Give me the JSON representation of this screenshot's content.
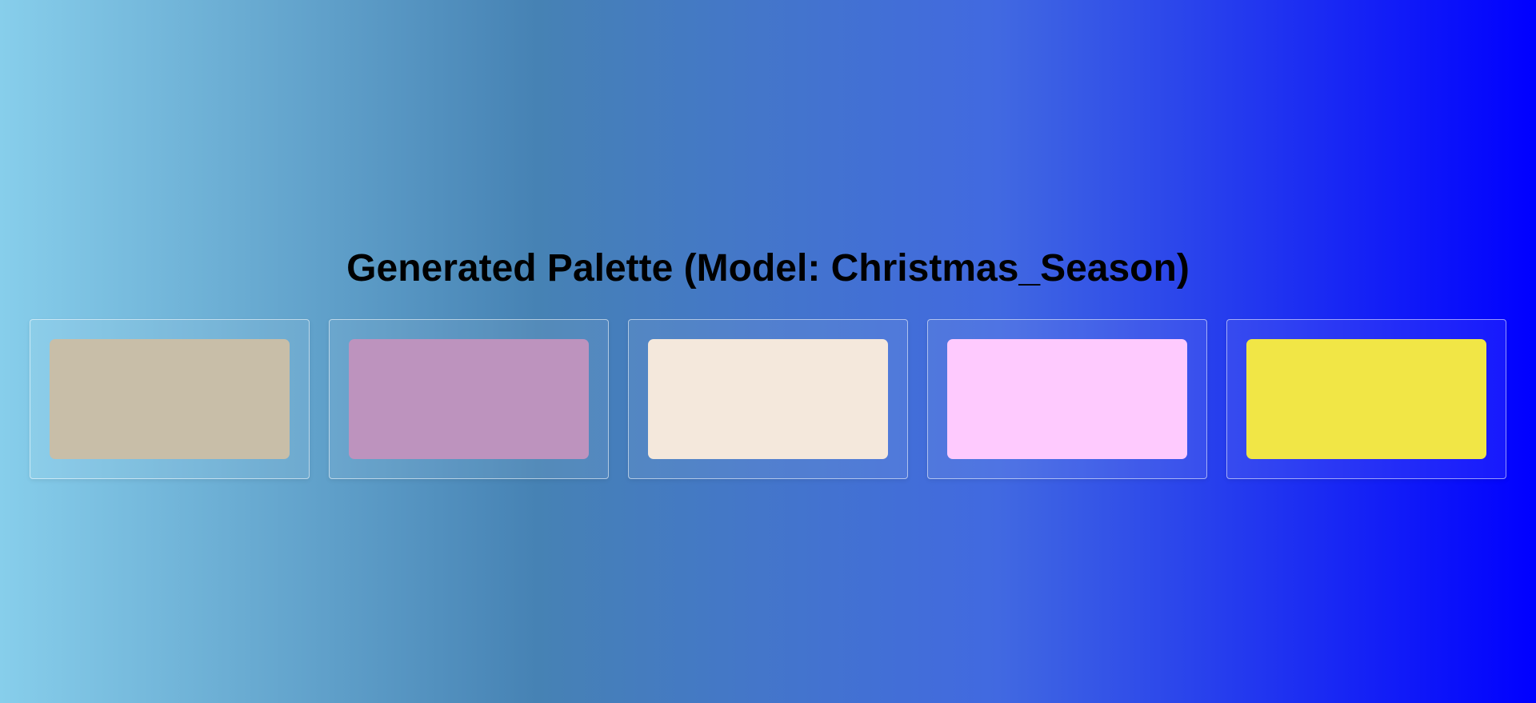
{
  "page": {
    "title": "Generated Palette (Model: Christmas_Season)"
  },
  "background": {
    "gradient_colors": [
      "#87ceeb",
      "#4682b4",
      "#4169e1",
      "#0000ff"
    ]
  },
  "palette": {
    "swatches": [
      {
        "color": "#c8bea8"
      },
      {
        "color": "#bd93be"
      },
      {
        "color": "#f4e8dc"
      },
      {
        "color": "#fecafe"
      },
      {
        "color": "#f1e646"
      }
    ]
  }
}
